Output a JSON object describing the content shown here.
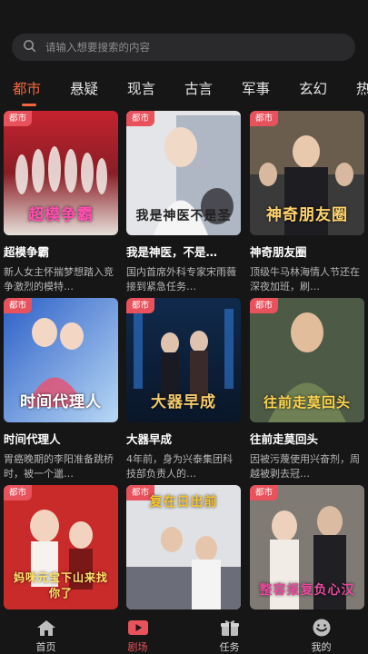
{
  "search": {
    "placeholder": "请输入想要搜索的内容"
  },
  "tabs": [
    {
      "label": "都市",
      "active": true
    },
    {
      "label": "悬疑"
    },
    {
      "label": "现言"
    },
    {
      "label": "古言"
    },
    {
      "label": "军事"
    },
    {
      "label": "玄幻"
    },
    {
      "label": "热"
    }
  ],
  "cards": [
    {
      "badge": "都市",
      "poster_text": "超模争霸",
      "title": "超模争霸",
      "desc": "新人女主怀揣梦想踏入竞争激烈的模特…"
    },
    {
      "badge": "都市",
      "poster_text": "我是神医不是圣",
      "title": "我是神医，不是…",
      "desc": "国内首席外科专家宋雨薇接到紧急任务…"
    },
    {
      "badge": "都市",
      "poster_text": "神奇朋友圈",
      "title": "神奇朋友圈",
      "desc": "顶级牛马林海情人节还在深夜加班，刷…"
    },
    {
      "badge": "都市",
      "poster_text": "时间代理人",
      "title": "时间代理人",
      "desc": "胃癌晚期的李阳准备跳桥时，被一个邋…"
    },
    {
      "badge": "都市",
      "poster_text": "大器早成",
      "title": "大器早成",
      "desc": "4年前，身为兴泰集团科技部负责人的…"
    },
    {
      "badge": "都市",
      "poster_text": "往前走莫回头",
      "title": "往前走莫回头",
      "desc": "因被污蔑使用兴奋剂，周越被剥去冠…"
    },
    {
      "badge": "都市",
      "poster_text": "妈咪元宝下山来找你了",
      "title": "",
      "desc": ""
    },
    {
      "badge": "都市",
      "poster_text": "复在日出前",
      "title": "",
      "desc": ""
    },
    {
      "badge": "都市",
      "poster_text": "整容报复负心汉",
      "title": "",
      "desc": ""
    }
  ],
  "bottom_nav": [
    {
      "label": "首页",
      "icon": "home-icon"
    },
    {
      "label": "剧场",
      "icon": "theater-icon",
      "active": true
    },
    {
      "label": "任务",
      "icon": "gift-icon"
    },
    {
      "label": "我的",
      "icon": "profile-icon"
    }
  ],
  "colors": {
    "accent": "#f0673d",
    "badge": "#e8525c",
    "background": "#161616"
  }
}
